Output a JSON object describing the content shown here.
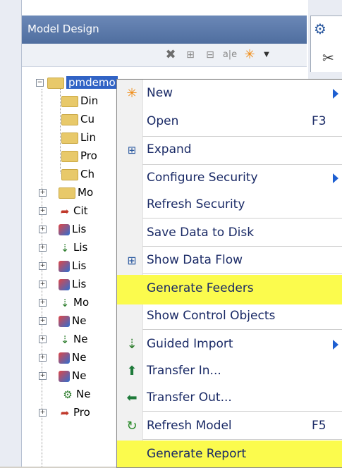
{
  "panel": {
    "title": "Model Design"
  },
  "toolbar": {
    "icons": [
      "delete-icon",
      "expand-icon",
      "collapse-icon",
      "rename-icon",
      "new-icon",
      "dropdown-icon"
    ]
  },
  "tree": {
    "root_label": "pmdemo",
    "items": [
      "Din",
      "Cu",
      "Lin",
      "Pro",
      "Ch",
      "Mo",
      "Cit",
      "Lis",
      "Lis",
      "Lis",
      "Lis",
      "Mo",
      "Ne",
      "Ne",
      "Ne",
      "Ne",
      "Ne",
      "Pro"
    ]
  },
  "menu": {
    "items": [
      {
        "label": "New",
        "shortcut": "",
        "submenu": true,
        "icon": "new-icon"
      },
      {
        "label": "Open",
        "shortcut": "F3",
        "submenu": false,
        "icon": ""
      },
      {
        "label": "Expand",
        "shortcut": "",
        "submenu": false,
        "icon": "expand-icon"
      },
      {
        "label": "Configure Security",
        "shortcut": "",
        "submenu": true,
        "icon": ""
      },
      {
        "label": "Refresh Security",
        "shortcut": "",
        "submenu": false,
        "icon": ""
      },
      {
        "label": "Save Data to Disk",
        "shortcut": "",
        "submenu": false,
        "icon": ""
      },
      {
        "label": "Show Data Flow",
        "shortcut": "",
        "submenu": false,
        "icon": "data-flow-icon"
      },
      {
        "label": "Generate Feeders",
        "shortcut": "",
        "submenu": false,
        "icon": "",
        "highlight": true
      },
      {
        "label": "Show Control Objects",
        "shortcut": "",
        "submenu": false,
        "icon": ""
      },
      {
        "label": "Guided Import",
        "shortcut": "",
        "submenu": true,
        "icon": "guided-import-icon"
      },
      {
        "label": "Transfer In...",
        "shortcut": "",
        "submenu": false,
        "icon": "transfer-in-icon"
      },
      {
        "label": "Transfer Out...",
        "shortcut": "",
        "submenu": false,
        "icon": "transfer-out-icon"
      },
      {
        "label": "Refresh Model",
        "shortcut": "F5",
        "submenu": false,
        "icon": "refresh-icon"
      },
      {
        "label": "Generate Report",
        "shortcut": "",
        "submenu": false,
        "icon": "",
        "highlight": true
      }
    ]
  },
  "colors": {
    "highlight": "#fbfb4d",
    "menu_text": "#1a2a66",
    "title_bar": "#5777aa",
    "selection": "#3163c5"
  }
}
